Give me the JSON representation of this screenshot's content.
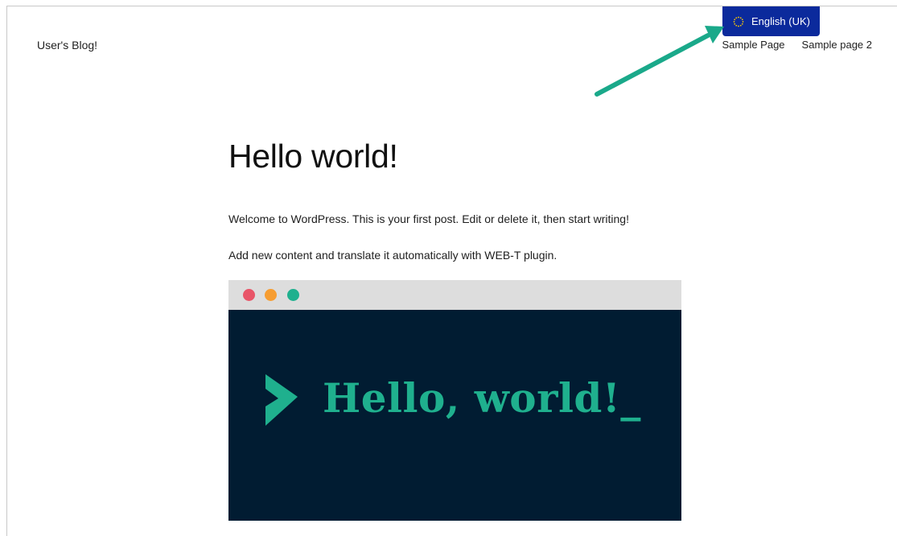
{
  "site": {
    "title": "User's Blog!"
  },
  "language_switcher": {
    "label": "English (UK)",
    "icon": "eu-flag-icon"
  },
  "nav": {
    "items": [
      {
        "label": "Sample Page"
      },
      {
        "label": "Sample page 2"
      }
    ]
  },
  "post": {
    "title": "Hello world!",
    "paragraphs": [
      "Welcome to WordPress. This is your first post. Edit or delete it, then start writing!",
      "Add new content and translate it automatically with WEB-T plugin."
    ]
  },
  "image": {
    "hero_text": "Hello, world!_",
    "window_dots": [
      "#e85568",
      "#f69d31",
      "#1fb08e"
    ]
  },
  "colors": {
    "switcher_bg": "#0b2a9c",
    "image_bg": "#011c32",
    "accent_green": "#1fb08e",
    "annotation_arrow": "#1aa98a"
  }
}
